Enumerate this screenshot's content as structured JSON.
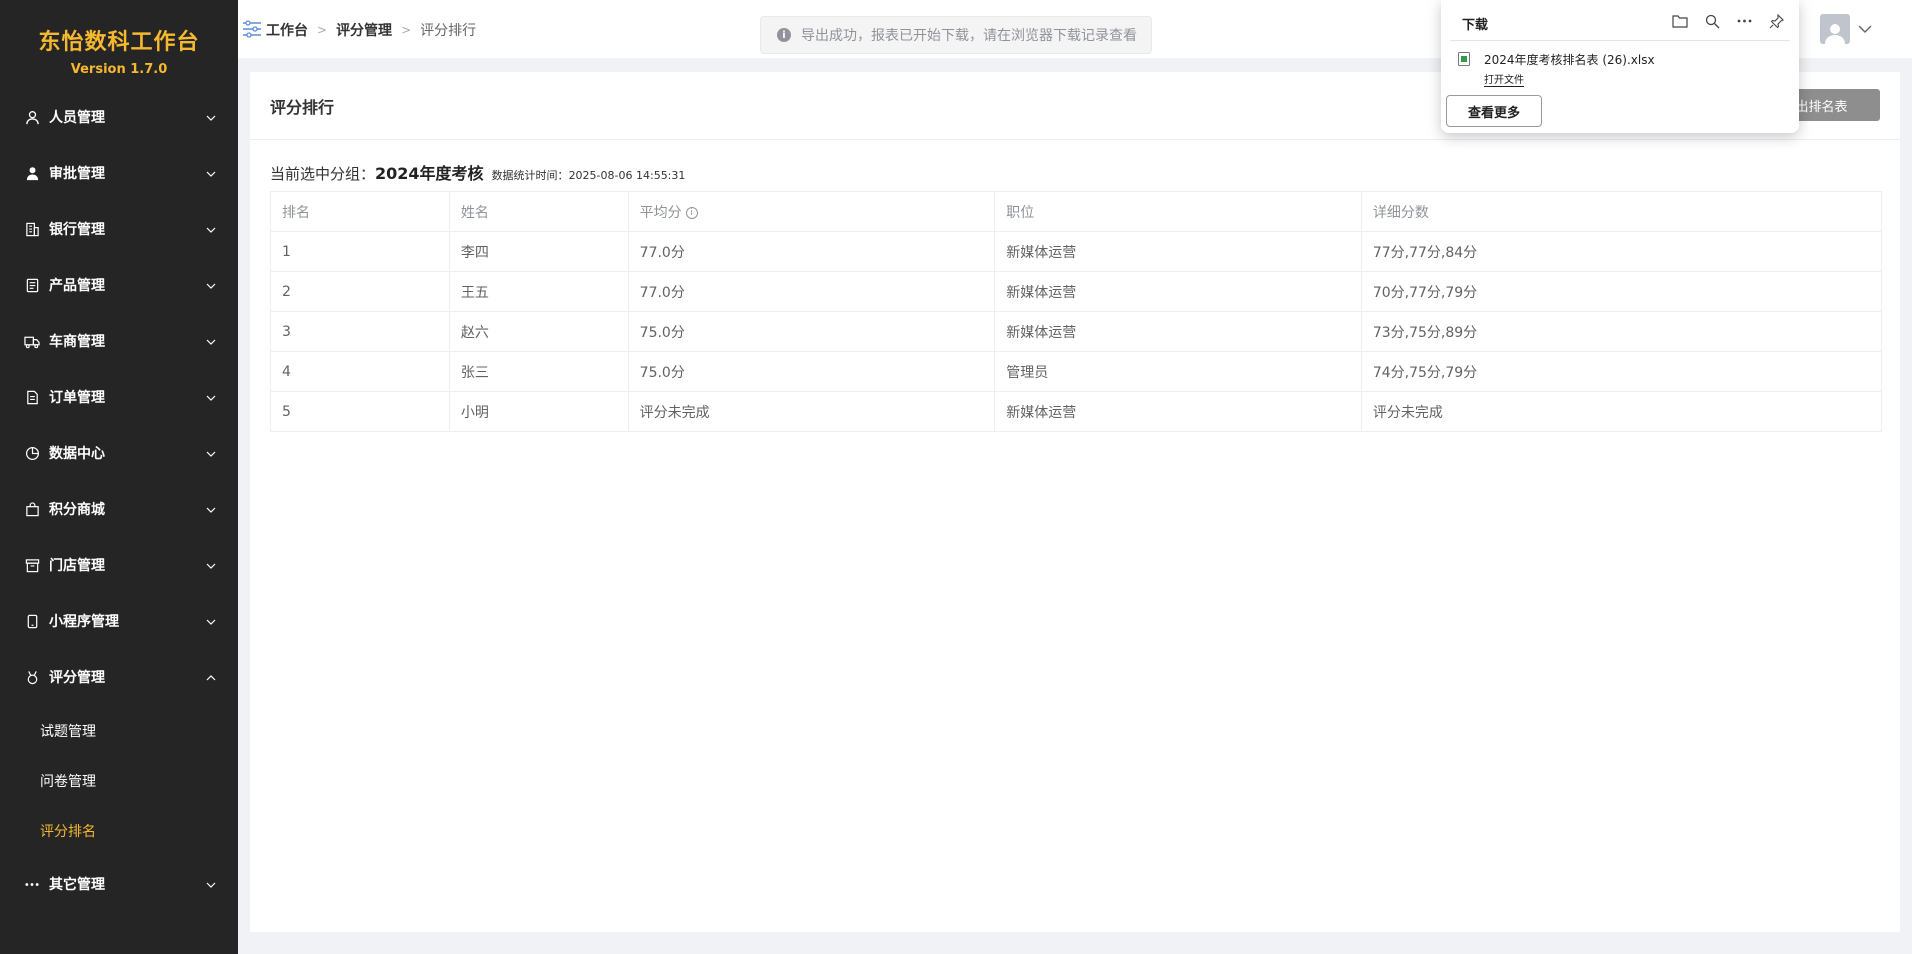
{
  "brand": {
    "title": "东怡数科工作台",
    "version": "Version 1.7.0"
  },
  "sidebar": {
    "items": [
      {
        "label": "人员管理",
        "icon": "user-icon"
      },
      {
        "label": "审批管理",
        "icon": "person-solid-icon"
      },
      {
        "label": "银行管理",
        "icon": "building-icon"
      },
      {
        "label": "产品管理",
        "icon": "document-icon"
      },
      {
        "label": "车商管理",
        "icon": "truck-icon"
      },
      {
        "label": "订单管理",
        "icon": "order-icon"
      },
      {
        "label": "数据中心",
        "icon": "pie-chart-icon"
      },
      {
        "label": "积分商城",
        "icon": "shopping-bag-icon"
      },
      {
        "label": "门店管理",
        "icon": "store-box-icon"
      },
      {
        "label": "小程序管理",
        "icon": "mobile-icon"
      },
      {
        "label": "评分管理",
        "icon": "medal-icon",
        "expanded": true
      },
      {
        "label": "其它管理",
        "icon": "more-dots-icon"
      }
    ],
    "submenu": [
      {
        "label": "试题管理",
        "active": false
      },
      {
        "label": "问卷管理",
        "active": false
      },
      {
        "label": "评分排名",
        "active": true
      }
    ]
  },
  "breadcrumb": {
    "home": "工作台",
    "parent": "评分管理",
    "current": "评分排行"
  },
  "toast": {
    "text": "导出成功，报表已开始下载，请在浏览器下载记录查看"
  },
  "card": {
    "title": "评分排行",
    "export_label": "导出排名表",
    "group_label": "当前选中分组：",
    "group_name": "2024年度考核",
    "time_label": "数据统计时间：",
    "time": "2025-08-06 14:55:31"
  },
  "table": {
    "headers": [
      "排名",
      "姓名",
      "平均分",
      "职位",
      "详细分数"
    ],
    "rows": [
      [
        "1",
        "李四",
        "77.0分",
        "新媒体运营",
        "77分,77分,84分"
      ],
      [
        "2",
        "王五",
        "77.0分",
        "新媒体运营",
        "70分,77分,79分"
      ],
      [
        "3",
        "赵六",
        "75.0分",
        "新媒体运营",
        "73分,75分,89分"
      ],
      [
        "4",
        "张三",
        "75.0分",
        "管理员",
        "74分,75分,79分"
      ],
      [
        "5",
        "小明",
        "评分未完成",
        "新媒体运营",
        "评分未完成"
      ]
    ]
  },
  "download": {
    "title": "下载",
    "filename": "2024年度考核排名表 (26).xlsx",
    "open_label": "打开文件",
    "more_label": "查看更多"
  },
  "colors": {
    "accent": "#f5b82e",
    "sidebar_bg": "#252525",
    "export_btn": "#8e8e8e"
  }
}
